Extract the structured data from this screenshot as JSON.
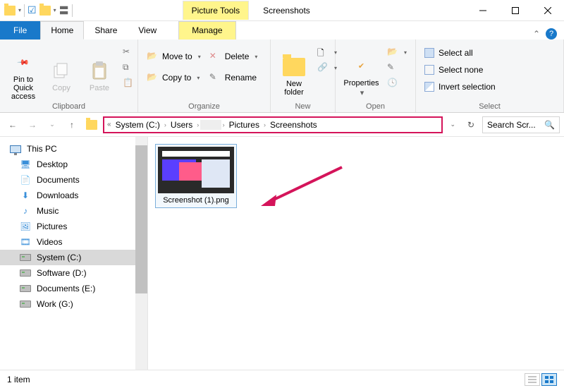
{
  "titlebar": {
    "tool_tab": "Picture Tools",
    "window_title": "Screenshots"
  },
  "tabs": {
    "file": "File",
    "home": "Home",
    "share": "Share",
    "view": "View",
    "manage": "Manage"
  },
  "ribbon": {
    "clipboard": {
      "pin": "Pin to Quick access",
      "copy": "Copy",
      "paste": "Paste",
      "label": "Clipboard"
    },
    "organize": {
      "move_to": "Move to",
      "copy_to": "Copy to",
      "delete": "Delete",
      "rename": "Rename",
      "label": "Organize"
    },
    "new": {
      "new_folder": "New folder",
      "label": "New"
    },
    "open": {
      "properties": "Properties",
      "label": "Open"
    },
    "select": {
      "select_all": "Select all",
      "select_none": "Select none",
      "invert": "Invert selection",
      "label": "Select"
    }
  },
  "path": {
    "segments": [
      "System (C:)",
      "Users",
      "",
      "Pictures",
      "Screenshots"
    ]
  },
  "search": {
    "placeholder": "Search Scr..."
  },
  "sidebar": {
    "root": "This PC",
    "items": [
      "Desktop",
      "Documents",
      "Downloads",
      "Music",
      "Pictures",
      "Videos",
      "System (C:)",
      "Software (D:)",
      "Documents (E:)",
      "Work (G:)"
    ]
  },
  "file": {
    "name": "Screenshot (1).png"
  },
  "status": {
    "count": "1 item"
  }
}
